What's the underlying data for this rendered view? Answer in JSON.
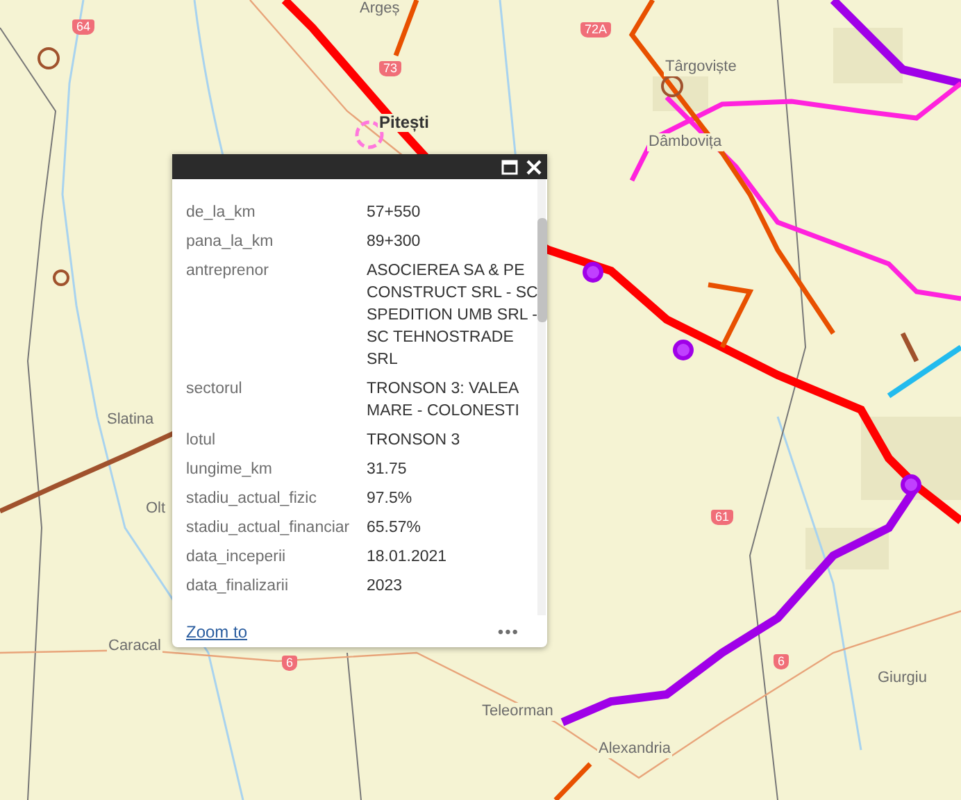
{
  "map": {
    "places": [
      {
        "text": "Argeș",
        "kind": "town"
      },
      {
        "text": "Pitești",
        "kind": "city"
      },
      {
        "text": "Târgoviște",
        "kind": "town"
      },
      {
        "text": "Dâmbovița",
        "kind": "town"
      },
      {
        "text": "Slatina",
        "kind": "town"
      },
      {
        "text": "Olt",
        "kind": "town"
      },
      {
        "text": "Caracal",
        "kind": "town"
      },
      {
        "text": "Teleorman",
        "kind": "town"
      },
      {
        "text": "Alexandria",
        "kind": "town"
      },
      {
        "text": "Giurgiu",
        "kind": "town"
      }
    ],
    "shields": [
      "64",
      "73",
      "72A",
      "61",
      "6",
      "6"
    ]
  },
  "popup": {
    "rows": [
      {
        "label": "de_la_km",
        "value": "57+550"
      },
      {
        "label": "pana_la_km",
        "value": "89+300"
      },
      {
        "label": "antreprenor",
        "value": "ASOCIEREA SA & PE CONSTRUCT SRL - SC SPEDITION UMB SRL - SC TEHNOSTRADE SRL"
      },
      {
        "label": "sectorul",
        "value": "TRONSON 3: VALEA MARE - COLONESTI"
      },
      {
        "label": "lotul",
        "value": "TRONSON 3"
      },
      {
        "label": "lungime_km",
        "value": "31.75"
      },
      {
        "label": "stadiu_actual_fizic",
        "value": "97.5%"
      },
      {
        "label": "stadiu_actual_financiar",
        "value": "65.57%"
      },
      {
        "label": "data_inceperii",
        "value": "18.01.2021"
      },
      {
        "label": "data_finalizarii",
        "value": "2023"
      }
    ],
    "zoom_link": "Zoom to",
    "more": "•••"
  }
}
